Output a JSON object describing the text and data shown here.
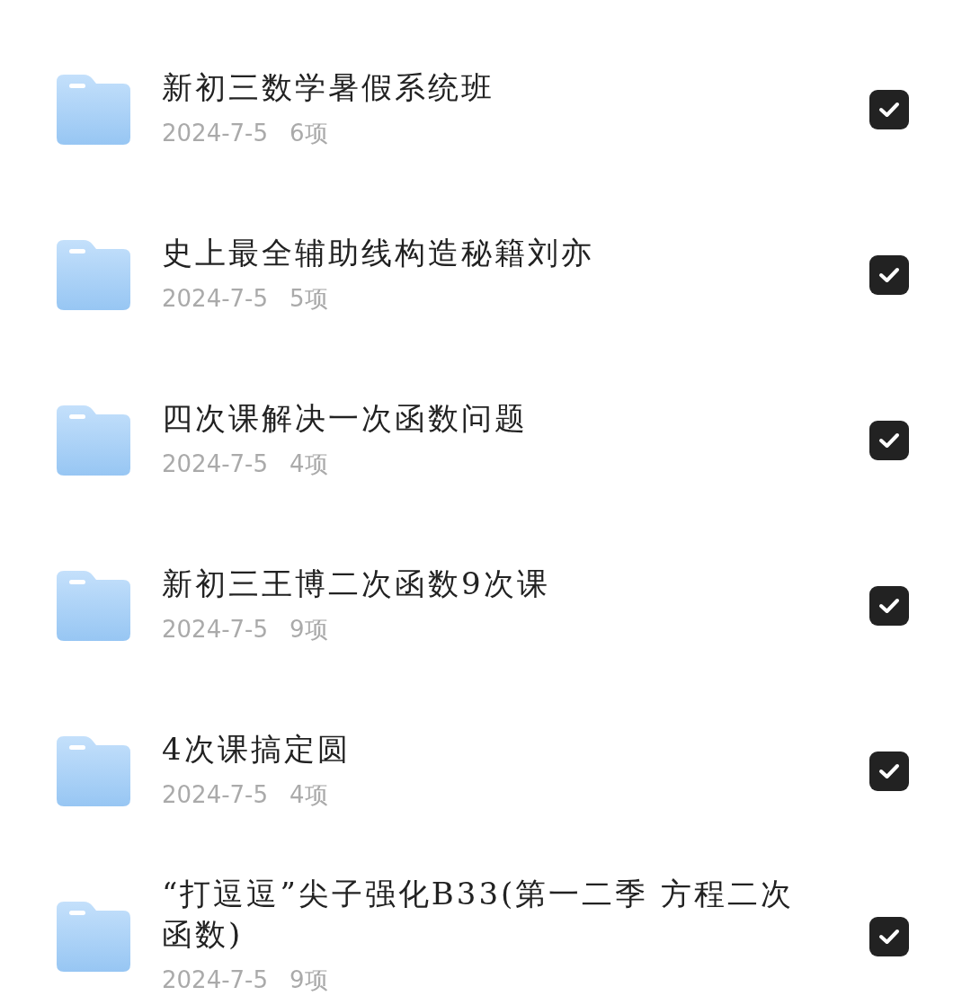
{
  "items": [
    {
      "title": "新初三数学暑假系统班",
      "date": "2024-7-5",
      "count": "6项",
      "checked": true
    },
    {
      "title": "史上最全辅助线构造秘籍刘亦",
      "date": "2024-7-5",
      "count": "5项",
      "checked": true
    },
    {
      "title": "四次课解决一次函数问题",
      "date": "2024-7-5",
      "count": "4项",
      "checked": true
    },
    {
      "title": "新初三王博二次函数9次课",
      "date": "2024-7-5",
      "count": "9项",
      "checked": true
    },
    {
      "title": "4次课搞定圆",
      "date": "2024-7-5",
      "count": "4项",
      "checked": true
    },
    {
      "title": "“打逗逗”尖子强化B33(第一二季 方程二次函数)",
      "date": "2024-7-5",
      "count": "9项",
      "checked": true
    }
  ]
}
